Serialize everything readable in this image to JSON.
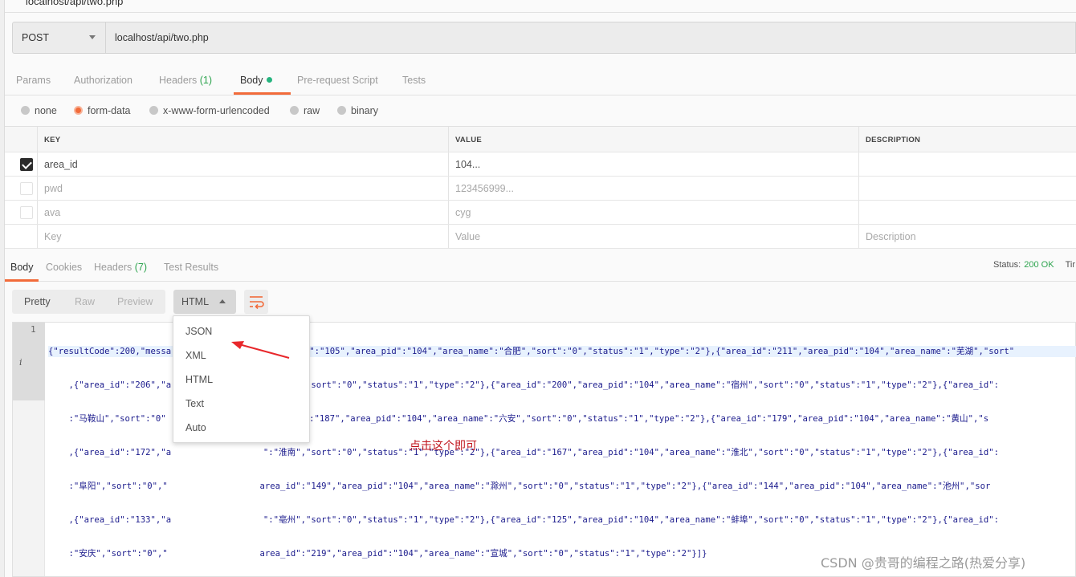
{
  "tab_title": "localhost/api/two.php",
  "request": {
    "method": "POST",
    "url": "localhost/api/two.php"
  },
  "request_tabs": [
    {
      "label": "Params"
    },
    {
      "label": "Authorization"
    },
    {
      "label": "Headers",
      "count": "(1)"
    },
    {
      "label": "Body"
    },
    {
      "label": "Pre-request Script"
    },
    {
      "label": "Tests"
    }
  ],
  "body_types": [
    "none",
    "form-data",
    "x-www-form-urlencoded",
    "raw",
    "binary"
  ],
  "selected_body_type": "form-data",
  "kv_table": {
    "headers": [
      "KEY",
      "VALUE",
      "DESCRIPTION"
    ],
    "rows": [
      {
        "key": "area_id",
        "value": "104...",
        "checked": true
      },
      {
        "key": "pwd",
        "value": "123456999...",
        "checked": false
      },
      {
        "key": "ava",
        "value": "cyg",
        "checked": false
      }
    ],
    "placeholder": {
      "key": "Key",
      "value": "Value",
      "description": "Description"
    }
  },
  "response_tabs": [
    {
      "label": "Body"
    },
    {
      "label": "Cookies"
    },
    {
      "label": "Headers",
      "count": "(7)"
    },
    {
      "label": "Test Results"
    }
  ],
  "status": {
    "label": "Status:",
    "value": "200 OK",
    "time_label": "Tir"
  },
  "view_modes": [
    "Pretty",
    "Raw",
    "Preview"
  ],
  "format": {
    "selected": "HTML",
    "options": [
      "JSON",
      "XML",
      "HTML",
      "Text",
      "Auto"
    ]
  },
  "editor": {
    "line_number": "1",
    "info_marker": "i",
    "lines": [
      "{\"resultCode\":200,\"messa                  {\"area_id\":\"105\",\"area_pid\":\"104\",\"area_name\":\"合肥\",\"sort\":\"0\",\"status\":\"1\",\"type\":\"2\"},{\"area_id\":\"211\",\"area_pid\":\"104\",\"area_name\":\"芜湖\",\"sort\"",
      "    ,{\"area_id\":\"206\",\"a                  \":\"铜陵\",\"sort\":\"0\",\"status\":\"1\",\"type\":\"2\"},{\"area_id\":\"200\",\"area_pid\":\"104\",\"area_name\":\"宿州\",\"sort\":\"0\",\"status\":\"1\",\"type\":\"2\"},{\"area_id\":",
      "    :\"马鞍山\",\"sort\":\"0\"                 ,{\"area_id\":\"187\",\"area_pid\":\"104\",\"area_name\":\"六安\",\"sort\":\"0\",\"status\":\"1\",\"type\":\"2\"},{\"area_id\":\"179\",\"area_pid\":\"104\",\"area_name\":\"黄山\",\"s",
      "    ,{\"area_id\":\"172\",\"a                  \":\"淮南\",\"sort\":\"0\",\"status\":\"1\",\"type\":\"2\"},{\"area_id\":\"167\",\"area_pid\":\"104\",\"area_name\":\"淮北\",\"sort\":\"0\",\"status\":\"1\",\"type\":\"2\"},{\"area_id\":",
      "    :\"阜阳\",\"sort\":\"0\",\"                  area_id\":\"149\",\"area_pid\":\"104\",\"area_name\":\"滁州\",\"sort\":\"0\",\"status\":\"1\",\"type\":\"2\"},{\"area_id\":\"144\",\"area_pid\":\"104\",\"area_name\":\"池州\",\"sor",
      "    ,{\"area_id\":\"133\",\"a                  \":\"亳州\",\"sort\":\"0\",\"status\":\"1\",\"type\":\"2\"},{\"area_id\":\"125\",\"area_pid\":\"104\",\"area_name\":\"蚌埠\",\"sort\":\"0\",\"status\":\"1\",\"type\":\"2\"},{\"area_id\":",
      "    :\"安庆\",\"sort\":\"0\",\"                  area_id\":\"219\",\"area_pid\":\"104\",\"area_name\":\"宣城\",\"sort\":\"0\",\"status\":\"1\",\"type\":\"2\"}]}"
    ]
  },
  "annotation": "点击这个即可",
  "watermark": "CSDN @贵哥的编程之路(热爱分享)",
  "colors": {
    "accent": "#f26b3a",
    "success": "#2ea44f",
    "annotation": "#c0141c",
    "arrow": "#e8272b"
  }
}
